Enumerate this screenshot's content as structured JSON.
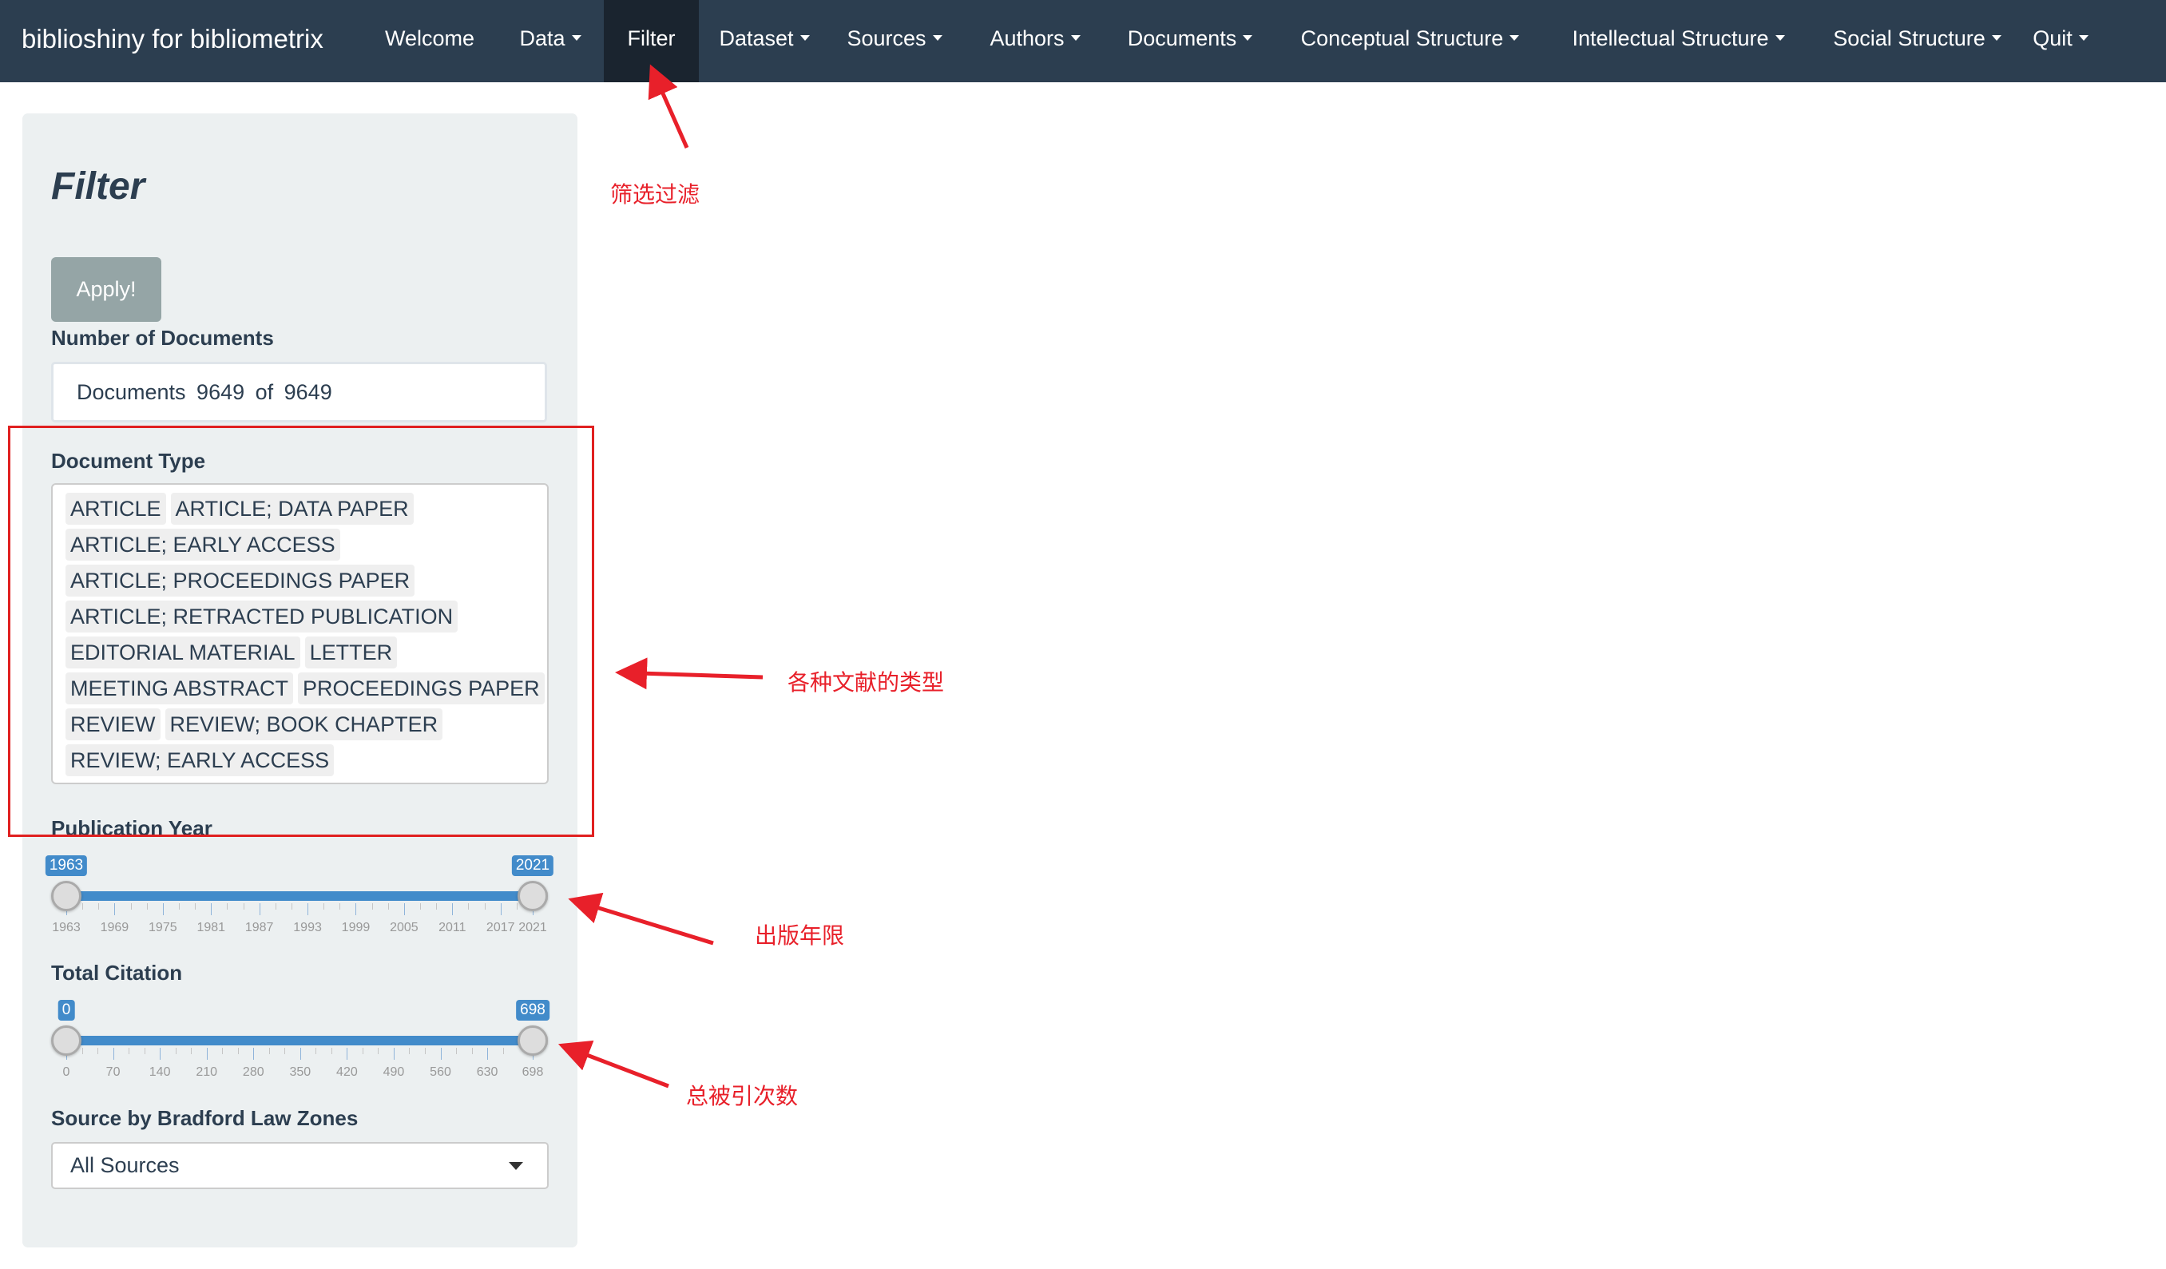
{
  "navbar": {
    "brand": "biblioshiny for bibliometrix",
    "items": [
      {
        "label": "Welcome",
        "dropdown": false,
        "active": false
      },
      {
        "label": "Data",
        "dropdown": true,
        "active": false
      },
      {
        "label": "Filter",
        "dropdown": false,
        "active": true
      },
      {
        "label": "Dataset",
        "dropdown": true,
        "active": false
      },
      {
        "label": "Sources",
        "dropdown": true,
        "active": false
      },
      {
        "label": "Authors",
        "dropdown": true,
        "active": false
      },
      {
        "label": "Documents",
        "dropdown": true,
        "active": false
      },
      {
        "label": "Conceptual Structure",
        "dropdown": true,
        "active": false
      },
      {
        "label": "Intellectual Structure",
        "dropdown": true,
        "active": false
      },
      {
        "label": "Social Structure",
        "dropdown": true,
        "active": false
      },
      {
        "label": "Quit",
        "dropdown": true,
        "active": false
      }
    ]
  },
  "filter_panel": {
    "title": "Filter",
    "apply_label": "Apply!",
    "num_docs_label": "Number of Documents",
    "num_docs_value": "Documents 9649 of 9649",
    "doc_type_label": "Document Type",
    "doc_type_rows": [
      [
        "ARTICLE",
        "ARTICLE; DATA PAPER"
      ],
      [
        "ARTICLE; EARLY ACCESS"
      ],
      [
        "ARTICLE; PROCEEDINGS PAPER"
      ],
      [
        "ARTICLE; RETRACTED PUBLICATION"
      ],
      [
        "EDITORIAL MATERIAL",
        "LETTER"
      ],
      [
        "MEETING ABSTRACT",
        "PROCEEDINGS PAPER"
      ],
      [
        "REVIEW",
        "REVIEW; BOOK CHAPTER"
      ],
      [
        "REVIEW; EARLY ACCESS"
      ]
    ],
    "pub_year": {
      "label": "Publication Year",
      "min": 1963,
      "max": 2021,
      "from": 1963,
      "to": 2021,
      "from_label": "1963",
      "to_label": "2021",
      "ticks": [
        "1963",
        "1969",
        "1975",
        "1981",
        "1987",
        "1993",
        "1999",
        "2005",
        "2011",
        "2017",
        "2021"
      ],
      "tick_values": [
        1963,
        1969,
        1975,
        1981,
        1987,
        1993,
        1999,
        2005,
        2011,
        2017,
        2021
      ]
    },
    "citation": {
      "label": "Total Citation",
      "min": 0,
      "max": 698,
      "from": 0,
      "to": 698,
      "from_label": "0",
      "to_label": "698",
      "ticks": [
        "0",
        "70",
        "140",
        "210",
        "280",
        "350",
        "420",
        "490",
        "560",
        "630",
        "698"
      ],
      "tick_values": [
        0,
        70,
        140,
        210,
        280,
        350,
        420,
        490,
        560,
        630,
        698
      ]
    },
    "bradford_label": "Source by Bradford Law Zones",
    "bradford_value": "All Sources"
  },
  "annotations": {
    "filter": "筛选过滤",
    "doc_types": "各种文献的类型",
    "pub_year": "出版年限",
    "citations": "总被引次数",
    "color": "#e8202a"
  }
}
